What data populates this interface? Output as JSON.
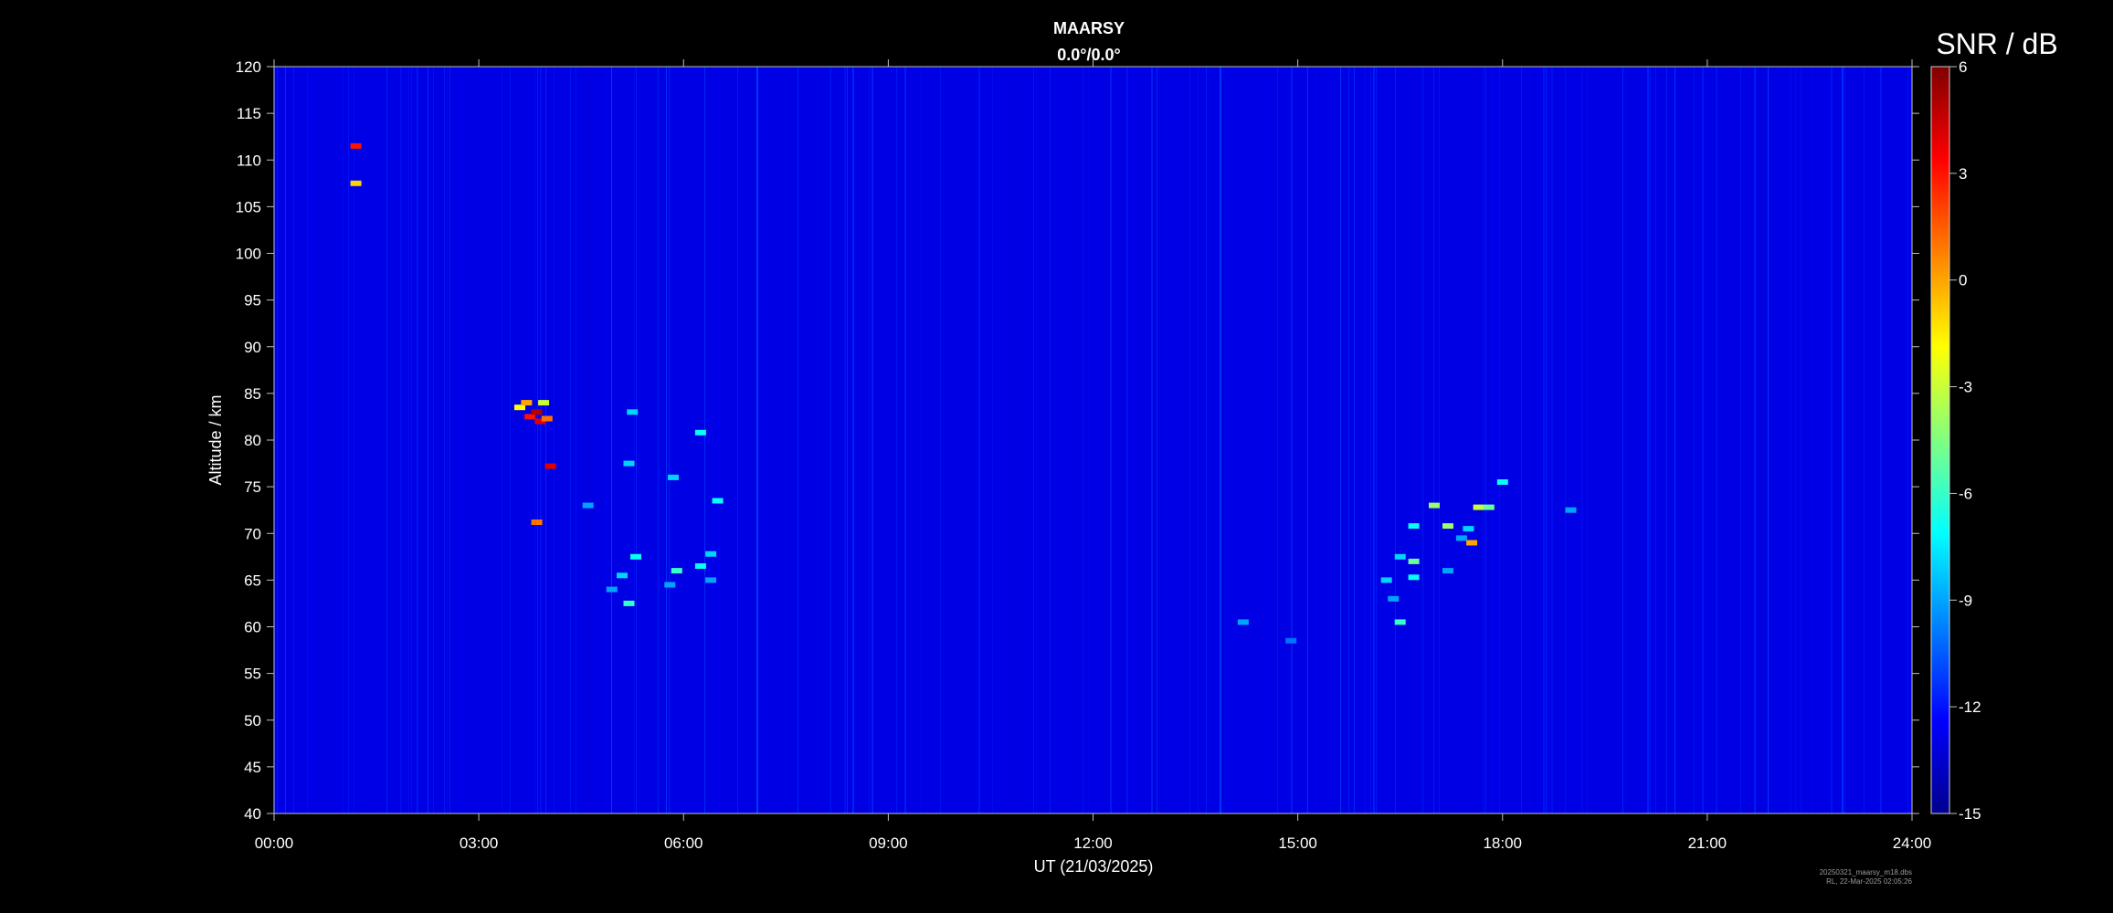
{
  "chart_data": {
    "type": "heatmap",
    "title": "MAARSY",
    "subtitle": "0.0°/0.0°",
    "xlabel": "UT (21/03/2025)",
    "ylabel": "Altitude / km",
    "x_range_hours": [
      0,
      24
    ],
    "x_tick_labels": [
      "00:00",
      "03:00",
      "06:00",
      "09:00",
      "12:00",
      "15:00",
      "18:00",
      "21:00",
      "24:00"
    ],
    "ylim": [
      40,
      120
    ],
    "y_ticks": [
      40,
      45,
      50,
      55,
      60,
      65,
      70,
      75,
      80,
      85,
      90,
      95,
      100,
      105,
      110,
      115,
      120
    ],
    "colorbar": {
      "label": "SNR / dB",
      "range": [
        -15,
        6
      ],
      "ticks": [
        6,
        3,
        0,
        -3,
        -6,
        -9,
        -12,
        -15
      ],
      "colormap": [
        "#00008f",
        "#0000ff",
        "#0080ff",
        "#00ffff",
        "#80ff80",
        "#ffff00",
        "#ff8000",
        "#ff0000",
        "#800000"
      ]
    },
    "background_snr_db": -13,
    "echoes": [
      {
        "t": 3.6,
        "alt": 83.5,
        "snr": -2
      },
      {
        "t": 3.7,
        "alt": 84.0,
        "snr": 0
      },
      {
        "t": 3.75,
        "alt": 82.5,
        "snr": 3
      },
      {
        "t": 3.85,
        "alt": 83.0,
        "snr": 5
      },
      {
        "t": 3.9,
        "alt": 82.0,
        "snr": 4
      },
      {
        "t": 4.0,
        "alt": 82.3,
        "snr": 1
      },
      {
        "t": 3.95,
        "alt": 84.0,
        "snr": -3
      },
      {
        "t": 4.05,
        "alt": 77.2,
        "snr": 4
      },
      {
        "t": 3.85,
        "alt": 71.2,
        "snr": 1
      },
      {
        "t": 1.2,
        "alt": 111.5,
        "snr": 3
      },
      {
        "t": 1.2,
        "alt": 107.5,
        "snr": -1
      },
      {
        "t": 5.25,
        "alt": 83.0,
        "snr": -8
      },
      {
        "t": 5.2,
        "alt": 77.5,
        "snr": -8
      },
      {
        "t": 6.25,
        "alt": 80.8,
        "snr": -7
      },
      {
        "t": 5.85,
        "alt": 76.0,
        "snr": -8
      },
      {
        "t": 6.5,
        "alt": 73.5,
        "snr": -7
      },
      {
        "t": 4.6,
        "alt": 73.0,
        "snr": -9
      },
      {
        "t": 5.3,
        "alt": 67.5,
        "snr": -7
      },
      {
        "t": 5.1,
        "alt": 65.5,
        "snr": -8
      },
      {
        "t": 4.95,
        "alt": 64.0,
        "snr": -9
      },
      {
        "t": 5.2,
        "alt": 62.5,
        "snr": -6
      },
      {
        "t": 5.9,
        "alt": 66.0,
        "snr": -6
      },
      {
        "t": 6.25,
        "alt": 66.5,
        "snr": -7
      },
      {
        "t": 6.4,
        "alt": 67.8,
        "snr": -8
      },
      {
        "t": 6.4,
        "alt": 65.0,
        "snr": -9
      },
      {
        "t": 5.8,
        "alt": 64.5,
        "snr": -9
      },
      {
        "t": 14.2,
        "alt": 60.5,
        "snr": -9
      },
      {
        "t": 14.9,
        "alt": 58.5,
        "snr": -10
      },
      {
        "t": 17.0,
        "alt": 73.0,
        "snr": -4
      },
      {
        "t": 17.65,
        "alt": 72.8,
        "snr": -3
      },
      {
        "t": 17.8,
        "alt": 72.8,
        "snr": -5
      },
      {
        "t": 18.0,
        "alt": 75.5,
        "snr": -7
      },
      {
        "t": 16.7,
        "alt": 70.8,
        "snr": -7
      },
      {
        "t": 17.2,
        "alt": 70.8,
        "snr": -4
      },
      {
        "t": 17.5,
        "alt": 70.5,
        "snr": -8
      },
      {
        "t": 17.4,
        "alt": 69.5,
        "snr": -9
      },
      {
        "t": 19.0,
        "alt": 72.5,
        "snr": -9
      },
      {
        "t": 16.5,
        "alt": 67.5,
        "snr": -8
      },
      {
        "t": 16.7,
        "alt": 67.0,
        "snr": -5
      },
      {
        "t": 16.3,
        "alt": 65.0,
        "snr": -8
      },
      {
        "t": 16.7,
        "alt": 65.3,
        "snr": -7
      },
      {
        "t": 17.2,
        "alt": 66.0,
        "snr": -9
      },
      {
        "t": 16.5,
        "alt": 60.5,
        "snr": -6
      },
      {
        "t": 16.4,
        "alt": 63.0,
        "snr": -9
      },
      {
        "t": 17.55,
        "alt": 69.0,
        "snr": 0
      }
    ]
  },
  "footer": {
    "filename": "20250321_maarsy_m18.dbs",
    "created": "RL, 22-Mar-2025 02:05:26"
  }
}
